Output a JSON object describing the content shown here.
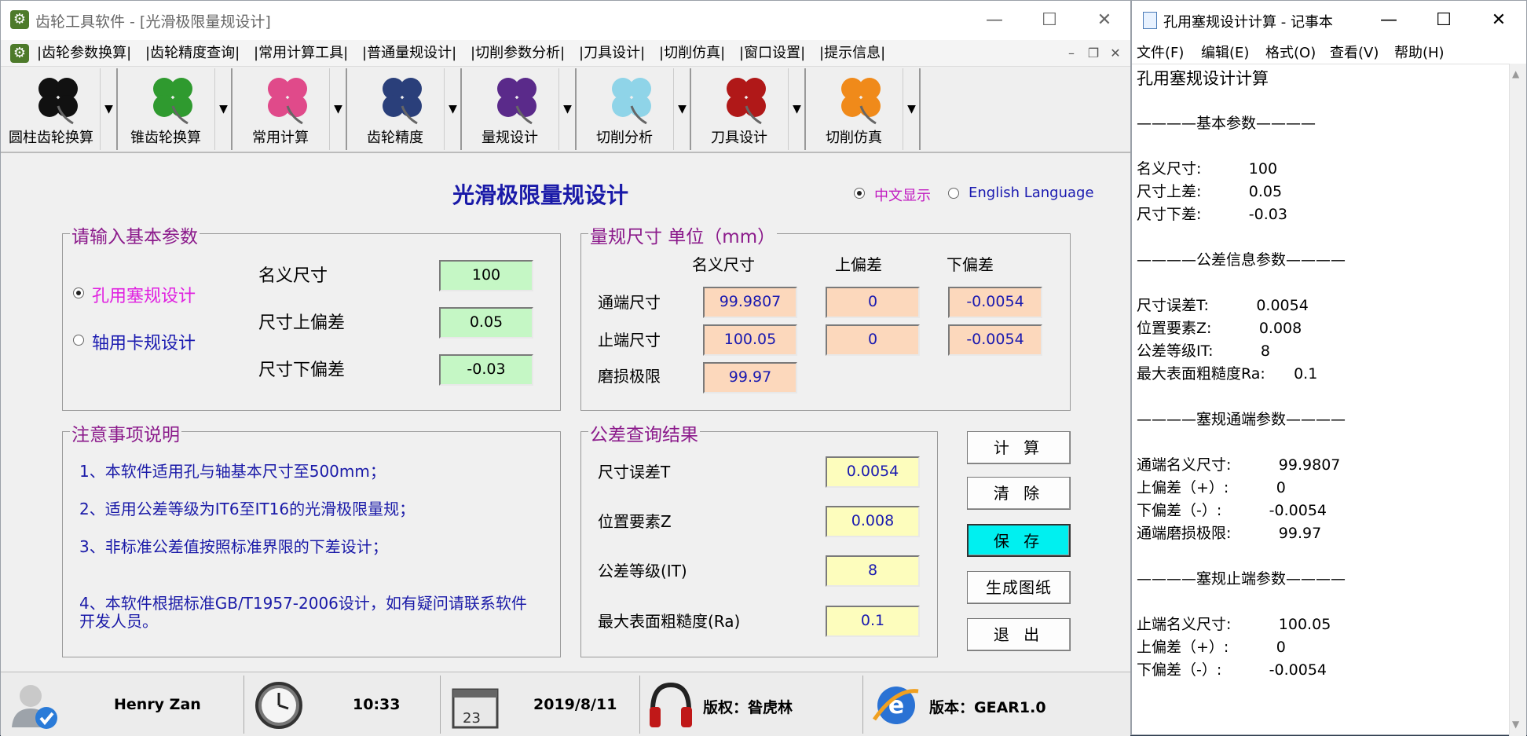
{
  "app": {
    "title": "齿轮工具软件 - [光滑极限量规设计]",
    "menu": [
      "|齿轮参数换算|",
      "|齿轮精度查询|",
      "|常用计算工具|",
      "|普通量规设计|",
      "|切削参数分析|",
      "|刀具设计|",
      "|切削仿真|",
      "|窗口设置|",
      "|提示信息|"
    ],
    "toolbar": [
      {
        "label": "圆柱齿轮换算",
        "color": "#111111"
      },
      {
        "label": "锥齿轮换算",
        "color": "#2f9a2f"
      },
      {
        "label": "常用计算",
        "color": "#e04a8a"
      },
      {
        "label": "齿轮精度",
        "color": "#2a3f7a"
      },
      {
        "label": "量规设计",
        "color": "#5a2a8a"
      },
      {
        "label": "切削分析",
        "color": "#8fd4e8"
      },
      {
        "label": "刀具设计",
        "color": "#b01818"
      },
      {
        "label": "切削仿真",
        "color": "#f08a1a"
      }
    ],
    "headline": "光滑极限量规设计",
    "lang": {
      "chinese": "中文显示",
      "english": "English Language"
    },
    "input_group": {
      "title": "请输入基本参数",
      "radio_hole": "孔用塞规设计",
      "radio_shaft": "轴用卡规设计",
      "nominal_label": "名义尺寸",
      "nominal_value": "100",
      "upper_label": "尺寸上偏差",
      "upper_value": "0.05",
      "lower_label": "尺寸下偏差",
      "lower_value": "-0.03"
    },
    "gauge_group": {
      "title": "量规尺寸 单位（mm）",
      "col_nominal": "名义尺寸",
      "col_upper": "上偏差",
      "col_lower": "下偏差",
      "go_label": "通端尺寸",
      "go_nominal": "99.9807",
      "go_upper": "0",
      "go_lower": "-0.0054",
      "nogo_label": "止端尺寸",
      "nogo_nominal": "100.05",
      "nogo_upper": "0",
      "nogo_lower": "-0.0054",
      "wear_label": "磨损极限",
      "wear_value": "99.97"
    },
    "notes_group": {
      "title": "注意事项说明",
      "note1": "1、本软件适用孔与轴基本尺寸至500mm；",
      "note2": "2、适用公差等级为IT6至IT16的光滑极限量规；",
      "note3": "3、非标准公差值按照标准界限的下差设计；",
      "note4a": "4、本软件根据标准GB/T1957-2006设计，如有疑问请联系软件",
      "note4b": "开发人员。"
    },
    "tolerance_group": {
      "title": "公差查询结果",
      "t_label": "尺寸误差T",
      "t_value": "0.0054",
      "z_label": "位置要素Z",
      "z_value": "0.008",
      "it_label": "公差等级(IT)",
      "it_value": "8",
      "ra_label": "最大表面粗糙度(Ra)",
      "ra_value": "0.1"
    },
    "buttons": {
      "calc": "计 算",
      "clear": "清 除",
      "save": "保 存",
      "drawing": "生成图纸",
      "exit": "退 出"
    },
    "status": {
      "user": "Henry Zan",
      "time": "10:33",
      "calendar_day": "23",
      "date": "2019/8/11",
      "copyright": "版权：昝虎林",
      "version": "版本：GEAR1.0"
    }
  },
  "notepad": {
    "title": "孔用塞规设计计算 - 记事本",
    "menu": [
      "文件(F)",
      "编辑(E)",
      "格式(O)",
      "查看(V)",
      "帮助(H)"
    ],
    "lines": [
      "孔用塞规设计计算",
      "",
      "————基本参数————",
      "",
      "名义尺寸:          100",
      "尺寸上差:          0.05",
      "尺寸下差:          -0.03",
      "",
      "————公差信息参数————",
      "",
      "尺寸误差T:          0.0054",
      "位置要素Z:          0.008",
      "公差等级IT:          8",
      "最大表面粗糙度Ra:      0.1",
      "",
      "————塞规通端参数————",
      "",
      "通端名义尺寸:          99.9807",
      "上偏差（+）:          0",
      "下偏差（-）:          -0.0054",
      "通端磨损极限:          99.97",
      "",
      "————塞规止端参数————",
      "",
      "止端名义尺寸:          100.05",
      "上偏差（+）:          0",
      "下偏差（-）:          -0.0054"
    ]
  }
}
